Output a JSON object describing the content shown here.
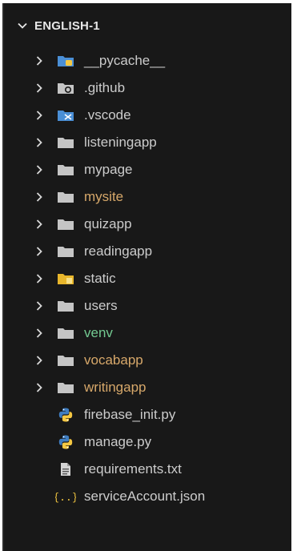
{
  "explorer": {
    "section_title": "ENGLISH-1",
    "items": [
      {
        "label": "__pycache__",
        "kind": "folder",
        "icon": "pycache-folder-icon",
        "color": "#cccccc",
        "name": "pycache"
      },
      {
        "label": ".github",
        "kind": "folder",
        "icon": "github-folder-icon",
        "color": "#cccccc",
        "name": "github"
      },
      {
        "label": ".vscode",
        "kind": "folder",
        "icon": "vscode-folder-icon",
        "color": "#cccccc",
        "name": "vscode"
      },
      {
        "label": "listeningapp",
        "kind": "folder",
        "icon": "folder-icon",
        "color": "#cccccc",
        "name": "listeningapp"
      },
      {
        "label": "mypage",
        "kind": "folder",
        "icon": "folder-icon",
        "color": "#cccccc",
        "name": "mypage"
      },
      {
        "label": "mysite",
        "kind": "folder",
        "icon": "folder-icon",
        "color": "#d7a86a",
        "name": "mysite"
      },
      {
        "label": "quizapp",
        "kind": "folder",
        "icon": "folder-icon",
        "color": "#cccccc",
        "name": "quizapp"
      },
      {
        "label": "readingapp",
        "kind": "folder",
        "icon": "folder-icon",
        "color": "#cccccc",
        "name": "readingapp"
      },
      {
        "label": "static",
        "kind": "folder",
        "icon": "static-folder-icon",
        "color": "#cccccc",
        "name": "static"
      },
      {
        "label": "users",
        "kind": "folder",
        "icon": "folder-icon",
        "color": "#cccccc",
        "name": "users"
      },
      {
        "label": "venv",
        "kind": "folder",
        "icon": "folder-icon",
        "color": "#73c991",
        "name": "venv"
      },
      {
        "label": "vocabapp",
        "kind": "folder",
        "icon": "folder-icon",
        "color": "#d7a86a",
        "name": "vocabapp"
      },
      {
        "label": "writingapp",
        "kind": "folder",
        "icon": "folder-icon",
        "color": "#d7a86a",
        "name": "writingapp"
      },
      {
        "label": "firebase_init.py",
        "kind": "file",
        "icon": "python-icon",
        "color": "#cccccc",
        "name": "firebase-init-py"
      },
      {
        "label": "manage.py",
        "kind": "file",
        "icon": "python-icon",
        "color": "#cccccc",
        "name": "manage-py"
      },
      {
        "label": "requirements.txt",
        "kind": "file",
        "icon": "text-file-icon",
        "color": "#cccccc",
        "name": "requirements-txt"
      },
      {
        "label": "serviceAccount.json",
        "kind": "file",
        "icon": "json-icon",
        "color": "#cccccc",
        "name": "serviceaccount-json"
      }
    ]
  },
  "colors": {
    "background": "#181818",
    "text": "#cccccc",
    "modified": "#d7a86a",
    "untracked": "#73c991",
    "folder": "#c5c5c5"
  }
}
